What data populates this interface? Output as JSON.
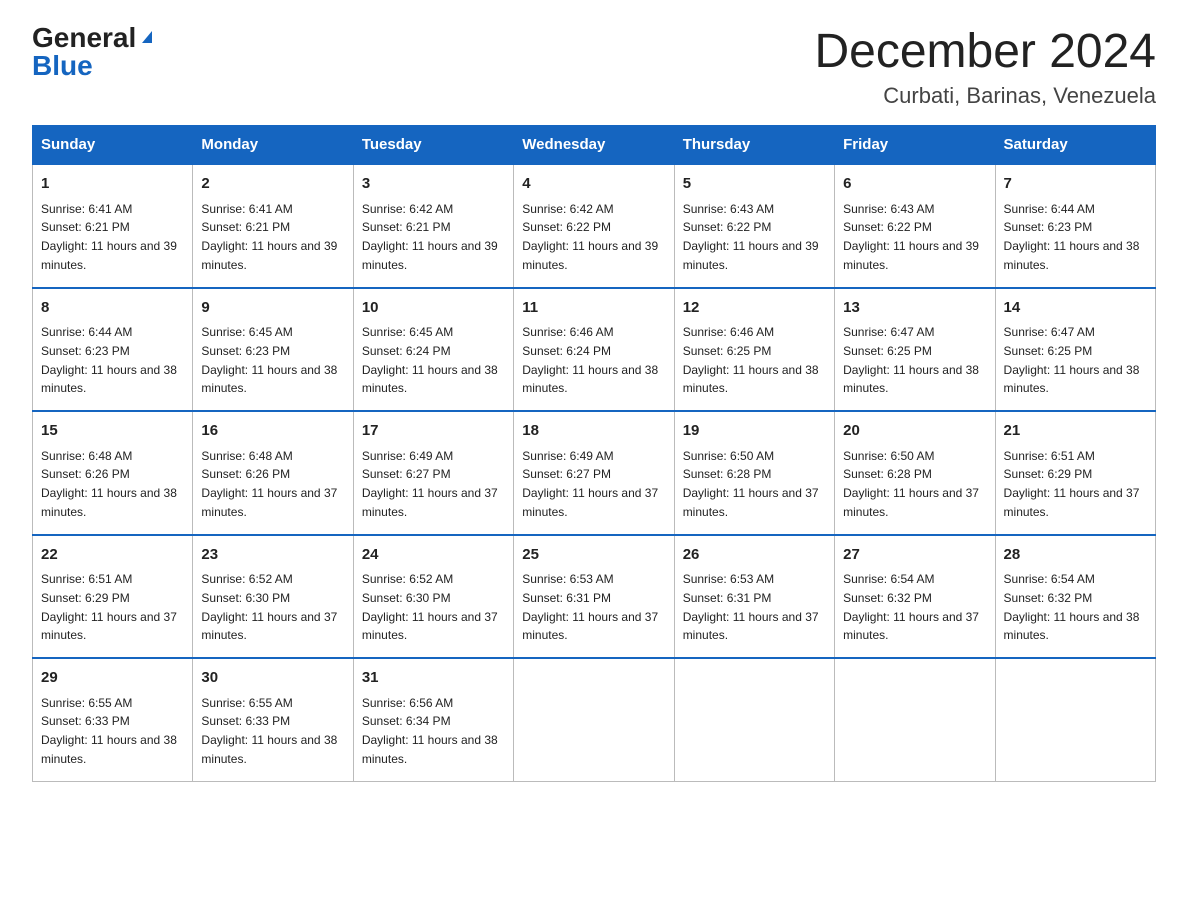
{
  "header": {
    "logo_general": "General",
    "logo_blue": "Blue",
    "title": "December 2024",
    "subtitle": "Curbati, Barinas, Venezuela"
  },
  "days_of_week": [
    "Sunday",
    "Monday",
    "Tuesday",
    "Wednesday",
    "Thursday",
    "Friday",
    "Saturday"
  ],
  "weeks": [
    [
      {
        "day": "1",
        "sunrise": "6:41 AM",
        "sunset": "6:21 PM",
        "daylight": "11 hours and 39 minutes."
      },
      {
        "day": "2",
        "sunrise": "6:41 AM",
        "sunset": "6:21 PM",
        "daylight": "11 hours and 39 minutes."
      },
      {
        "day": "3",
        "sunrise": "6:42 AM",
        "sunset": "6:21 PM",
        "daylight": "11 hours and 39 minutes."
      },
      {
        "day": "4",
        "sunrise": "6:42 AM",
        "sunset": "6:22 PM",
        "daylight": "11 hours and 39 minutes."
      },
      {
        "day": "5",
        "sunrise": "6:43 AM",
        "sunset": "6:22 PM",
        "daylight": "11 hours and 39 minutes."
      },
      {
        "day": "6",
        "sunrise": "6:43 AM",
        "sunset": "6:22 PM",
        "daylight": "11 hours and 39 minutes."
      },
      {
        "day": "7",
        "sunrise": "6:44 AM",
        "sunset": "6:23 PM",
        "daylight": "11 hours and 38 minutes."
      }
    ],
    [
      {
        "day": "8",
        "sunrise": "6:44 AM",
        "sunset": "6:23 PM",
        "daylight": "11 hours and 38 minutes."
      },
      {
        "day": "9",
        "sunrise": "6:45 AM",
        "sunset": "6:23 PM",
        "daylight": "11 hours and 38 minutes."
      },
      {
        "day": "10",
        "sunrise": "6:45 AM",
        "sunset": "6:24 PM",
        "daylight": "11 hours and 38 minutes."
      },
      {
        "day": "11",
        "sunrise": "6:46 AM",
        "sunset": "6:24 PM",
        "daylight": "11 hours and 38 minutes."
      },
      {
        "day": "12",
        "sunrise": "6:46 AM",
        "sunset": "6:25 PM",
        "daylight": "11 hours and 38 minutes."
      },
      {
        "day": "13",
        "sunrise": "6:47 AM",
        "sunset": "6:25 PM",
        "daylight": "11 hours and 38 minutes."
      },
      {
        "day": "14",
        "sunrise": "6:47 AM",
        "sunset": "6:25 PM",
        "daylight": "11 hours and 38 minutes."
      }
    ],
    [
      {
        "day": "15",
        "sunrise": "6:48 AM",
        "sunset": "6:26 PM",
        "daylight": "11 hours and 38 minutes."
      },
      {
        "day": "16",
        "sunrise": "6:48 AM",
        "sunset": "6:26 PM",
        "daylight": "11 hours and 37 minutes."
      },
      {
        "day": "17",
        "sunrise": "6:49 AM",
        "sunset": "6:27 PM",
        "daylight": "11 hours and 37 minutes."
      },
      {
        "day": "18",
        "sunrise": "6:49 AM",
        "sunset": "6:27 PM",
        "daylight": "11 hours and 37 minutes."
      },
      {
        "day": "19",
        "sunrise": "6:50 AM",
        "sunset": "6:28 PM",
        "daylight": "11 hours and 37 minutes."
      },
      {
        "day": "20",
        "sunrise": "6:50 AM",
        "sunset": "6:28 PM",
        "daylight": "11 hours and 37 minutes."
      },
      {
        "day": "21",
        "sunrise": "6:51 AM",
        "sunset": "6:29 PM",
        "daylight": "11 hours and 37 minutes."
      }
    ],
    [
      {
        "day": "22",
        "sunrise": "6:51 AM",
        "sunset": "6:29 PM",
        "daylight": "11 hours and 37 minutes."
      },
      {
        "day": "23",
        "sunrise": "6:52 AM",
        "sunset": "6:30 PM",
        "daylight": "11 hours and 37 minutes."
      },
      {
        "day": "24",
        "sunrise": "6:52 AM",
        "sunset": "6:30 PM",
        "daylight": "11 hours and 37 minutes."
      },
      {
        "day": "25",
        "sunrise": "6:53 AM",
        "sunset": "6:31 PM",
        "daylight": "11 hours and 37 minutes."
      },
      {
        "day": "26",
        "sunrise": "6:53 AM",
        "sunset": "6:31 PM",
        "daylight": "11 hours and 37 minutes."
      },
      {
        "day": "27",
        "sunrise": "6:54 AM",
        "sunset": "6:32 PM",
        "daylight": "11 hours and 37 minutes."
      },
      {
        "day": "28",
        "sunrise": "6:54 AM",
        "sunset": "6:32 PM",
        "daylight": "11 hours and 38 minutes."
      }
    ],
    [
      {
        "day": "29",
        "sunrise": "6:55 AM",
        "sunset": "6:33 PM",
        "daylight": "11 hours and 38 minutes."
      },
      {
        "day": "30",
        "sunrise": "6:55 AM",
        "sunset": "6:33 PM",
        "daylight": "11 hours and 38 minutes."
      },
      {
        "day": "31",
        "sunrise": "6:56 AM",
        "sunset": "6:34 PM",
        "daylight": "11 hours and 38 minutes."
      },
      null,
      null,
      null,
      null
    ]
  ]
}
